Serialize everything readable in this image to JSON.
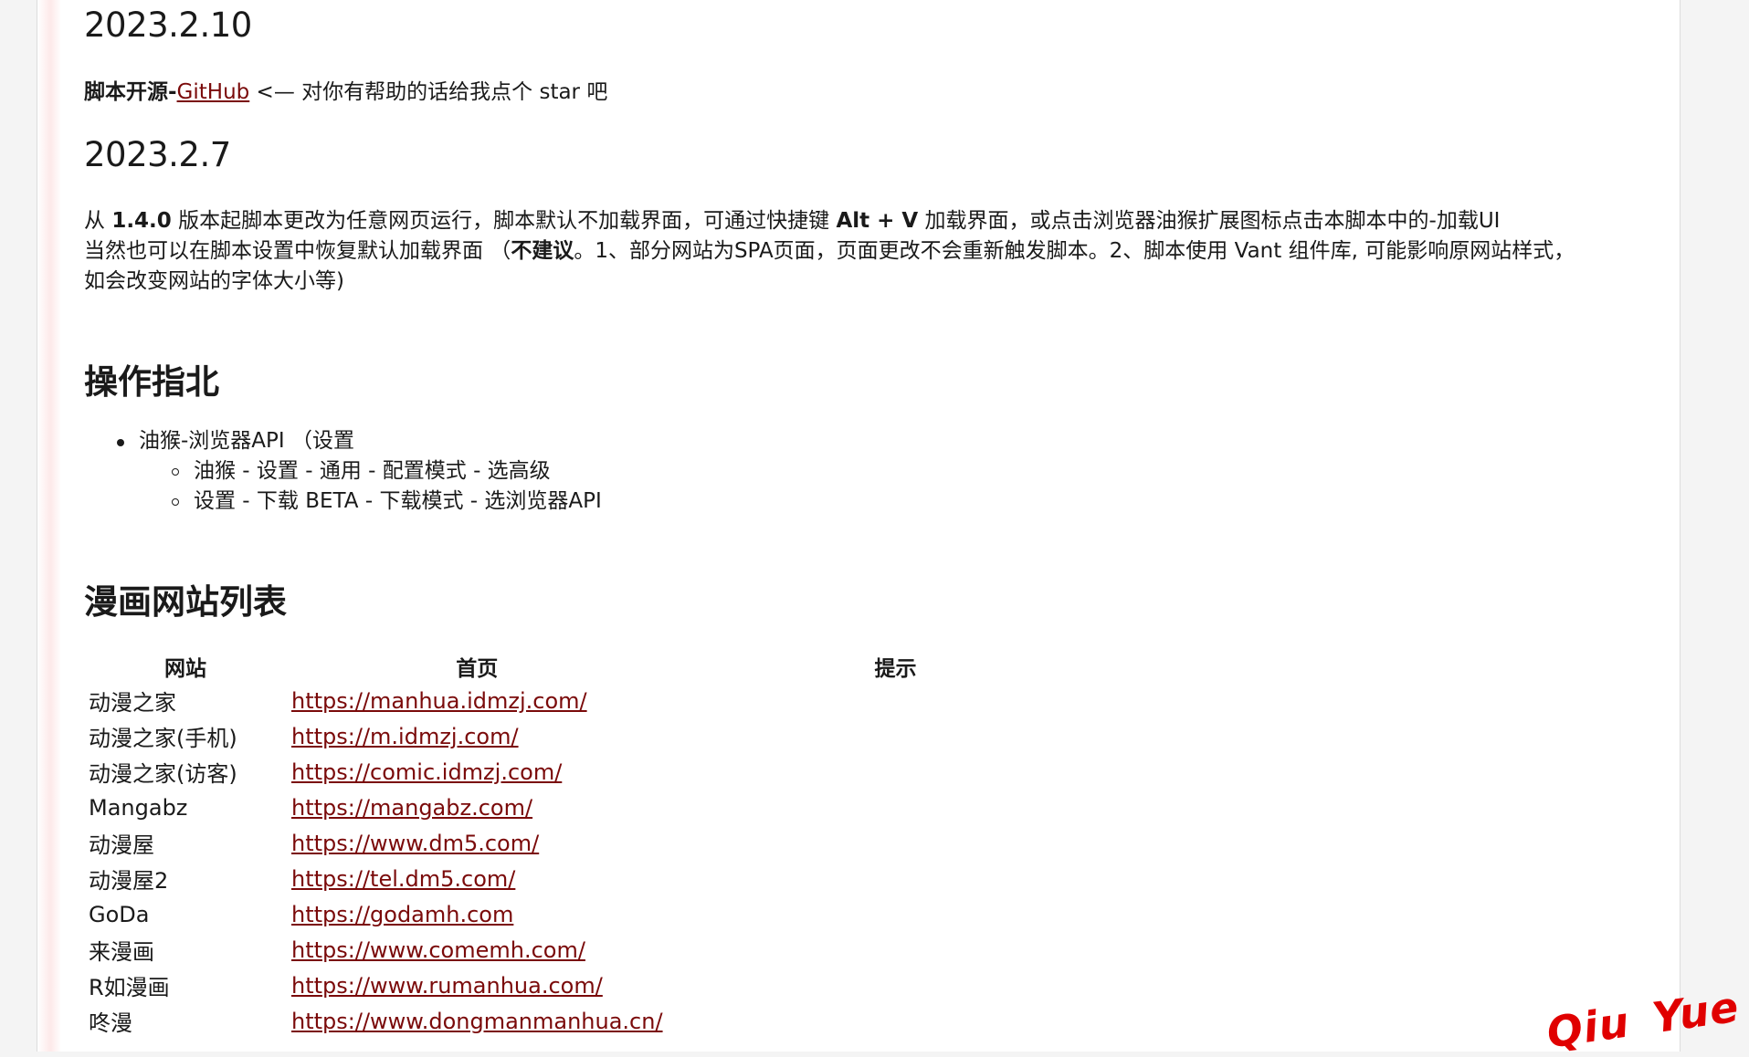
{
  "sections": {
    "v1": {
      "title": "2023.2.10",
      "bold": "脚本开源-",
      "link": "GitHub",
      "text": " <— 对你有帮助的话给我点个 star 吧"
    },
    "v2": {
      "title": "2023.2.7",
      "line1_a": "从 ",
      "line1_b": "1.4.0",
      "line1_c": " 版本起脚本更改为任意网页运行，脚本默认不加载界面，可通过快捷键 ",
      "line1_d": "Alt + V",
      "line1_e": " 加载界面，或点击浏览器油猴扩展图标点击本脚本中的-加载UI",
      "line2_a": "当然也可以在脚本设置中恢复默认加载界面 （",
      "line2_b": "不建议",
      "line2_c": "。1、部分网站为SPA页面，页面更改不会重新触发脚本。2、脚本使用 Vant 组件库, 可能影响原网站样式，",
      "line3": "如会改变网站的字体大小等)"
    },
    "guide": {
      "title": "操作指北",
      "item": "油猴-浏览器API （设置",
      "sub1": "油猴 - 设置 - 通用 - 配置模式 - 选高级",
      "sub2": "设置 - 下载 BETA - 下载模式 - 选浏览器API"
    },
    "sites": {
      "title": "漫画网站列表",
      "headers": [
        "网站",
        "首页",
        "提示"
      ],
      "rows": [
        {
          "name": "动漫之家",
          "url": "https://manhua.idmzj.com/"
        },
        {
          "name": "动漫之家(手机)",
          "url": "https://m.idmzj.com/"
        },
        {
          "name": "动漫之家(访客)",
          "url": "https://comic.idmzj.com/"
        },
        {
          "name": "Mangabz",
          "url": "https://mangabz.com/"
        },
        {
          "name": "动漫屋",
          "url": "https://www.dm5.com/"
        },
        {
          "name": "动漫屋2",
          "url": "https://tel.dm5.com/"
        },
        {
          "name": "GoDa",
          "url": "https://godamh.com"
        },
        {
          "name": "来漫画",
          "url": "https://www.comemh.com/"
        },
        {
          "name": "R如漫画",
          "url": "https://www.rumanhua.com/"
        },
        {
          "name": "咚漫",
          "url": "https://www.dongmanmanhua.cn/"
        }
      ]
    }
  },
  "watermark": {
    "a": "Qiu",
    "b": "Yue",
    "color": "#e00000"
  },
  "colors": {
    "link": "#7a0a0a",
    "accent_edge": "#fde9e9"
  }
}
